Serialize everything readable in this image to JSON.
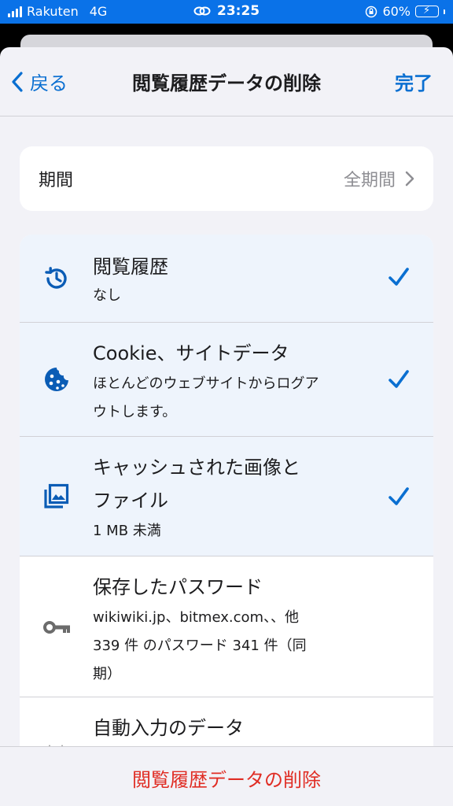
{
  "status_bar": {
    "carrier": "Rakuten",
    "network": "4G",
    "time": "23:25",
    "battery": "60%",
    "battery_level": 0.6
  },
  "nav": {
    "back_label": "戻る",
    "title": "閲覧履歴データの削除",
    "done_label": "完了"
  },
  "period": {
    "label": "期間",
    "value": "全期間"
  },
  "items": [
    {
      "title": "閲覧履歴",
      "subtitle": "なし",
      "icon": "history-icon",
      "checked": true
    },
    {
      "title": "Cookie、サイトデータ",
      "subtitle_lines": [
        "ほとんどのウェブサイトからログア",
        "ウトします。"
      ],
      "icon": "cookie-icon",
      "checked": true
    },
    {
      "title_lines": [
        "キャッシュされた画像と",
        "ファイル"
      ],
      "subtitle": "1 MB 未満",
      "icon": "image-icon",
      "checked": true
    },
    {
      "title": "保存したパスワード",
      "subtitle_lines": [
        "wikiwiki.jp、bitmex.com、、他",
        "339 件 のパスワード 341 件（同",
        "期）"
      ],
      "icon": "key-icon",
      "checked": false
    },
    {
      "title": "自動入力のデータ",
      "icon": "autofill-icon",
      "checked": false
    }
  ],
  "footer": {
    "delete_label": "閲覧履歴データの削除"
  },
  "colors": {
    "accent": "#0a6fd1",
    "destructive": "#e02d24",
    "status_bar": "#0a72e8"
  }
}
